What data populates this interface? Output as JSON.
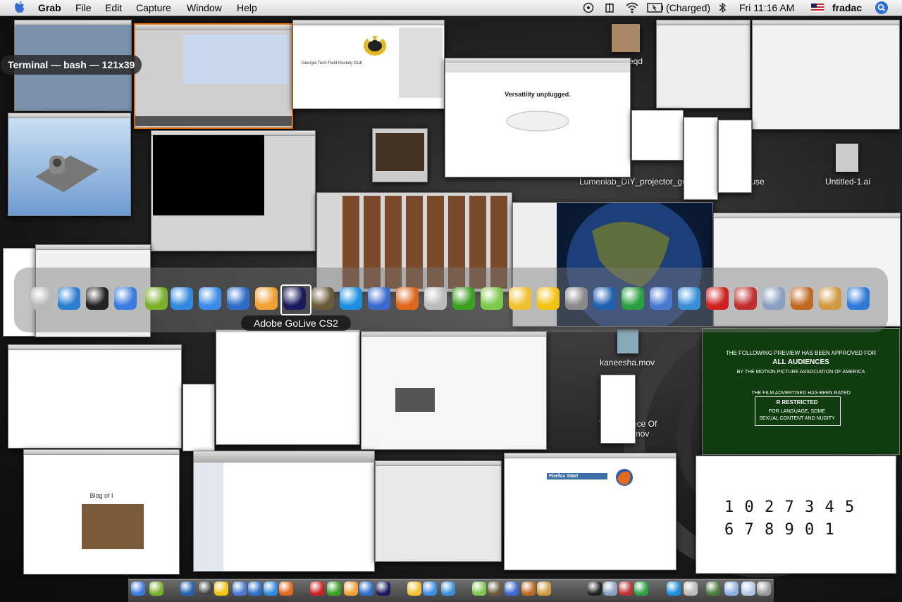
{
  "menubar": {
    "app_name": "Grab",
    "menus": [
      "File",
      "Edit",
      "Capture",
      "Window",
      "Help"
    ],
    "battery_status": "(Charged)",
    "clock": "Fri 11:16 AM",
    "user": "fradac"
  },
  "windows": {
    "terminal_label": "Terminal — bash — 121x39",
    "hockey_text": "Georgia Tech Field Hockey Club",
    "apple_headline": "Versatility unplugged.",
    "blog_title": "Blog of I",
    "firefox_start": "Firefox Start",
    "preview_lines": [
      "THE FOLLOWING PREVIEW HAS BEEN APPROVED FOR",
      "ALL AUDIENCES",
      "BY THE MOTION PICTURE ASSOCIATION OF AMERICA",
      "THE FILM ADVERTISED HAS BEEN RATED",
      "R  RESTRICTED",
      "FOR LANGUAGE, SOME",
      "SEXUAL CONTENT AND NUDITY"
    ],
    "digits_row1": "1 0 2 7 3 4 5",
    "digits_row2": "6 7 8 9 0 1"
  },
  "desktop_icons": {
    "reqd": "reqd",
    "lumenlab": "Lumenlab_DIY_projector_guide_v2.0.pdf",
    "use": "use",
    "untitled": "Untitled-1.ai",
    "kaneesha": "kaneesha.mov",
    "mov_title": "The Science Of",
    "mov_ext": "mov"
  },
  "switcher": {
    "selected_label": "Adobe GoLive CS2",
    "icons": [
      "grab-icon",
      "quill-icon",
      "terminal-icon",
      "finder-icon",
      "golive-e-icon",
      "safari-icon",
      "ichat-icon",
      "network-icon",
      "photo-icon",
      "golive-icon",
      "iphoto-icon",
      "quicktime-icon",
      "imovie-icon",
      "firefox-icon",
      "apple-icon",
      "dreamweaver-icon",
      "itunes-icon",
      "messenger-icon",
      "duck-icon",
      "search-icon",
      "earth-icon",
      "frog-icon",
      "mail-icon",
      "buddies-icon",
      "flash-icon",
      "zip-icon",
      "syringe-icon",
      "guitar-icon",
      "preview-icon",
      "dvd-icon"
    ]
  },
  "dock": {
    "icons": [
      "finder-icon",
      "golive-e-icon",
      "earth-icon",
      "camera-icon",
      "duck-icon",
      "mail-icon",
      "network-icon",
      "safari-icon",
      "firefox-icon",
      "flash-icon",
      "dreamweaver-icon",
      "photo-icon",
      "writer-icon",
      "golive-icon",
      "messenger-icon",
      "ichat-icon",
      "buddies-icon",
      "itunes-icon",
      "iphoto-icon",
      "imovie-icon",
      "guitar-icon",
      "preview-icon",
      "terminal-icon",
      "syringe-icon",
      "zip-icon",
      "frog-icon",
      "quicktime-icon",
      "grab-icon",
      "plant-icon",
      "folder-icon",
      "documents-icon",
      "trash-icon"
    ]
  },
  "colors": {
    "preview_green": "#0f3d0f",
    "menubar_bg": "#e8e8e8",
    "switcher_bg": "#7a7a7a",
    "selection": "#ffffff"
  }
}
